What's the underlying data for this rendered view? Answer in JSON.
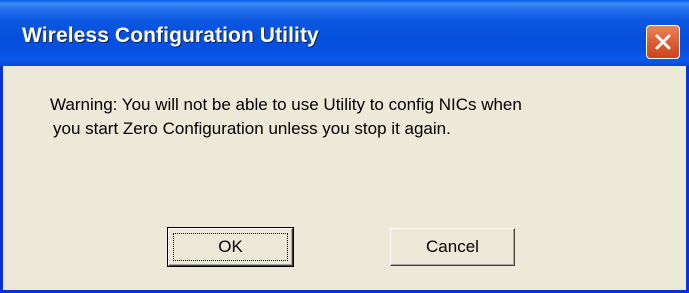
{
  "window": {
    "title": "Wireless Configuration Utility"
  },
  "message": {
    "line1": "Warning: You will not be able to use Utility to config NICs when",
    "line2": "you start Zero Configuration unless you stop it again."
  },
  "buttons": {
    "ok_label": "OK",
    "cancel_label": "Cancel"
  },
  "icons": {
    "close": "close-icon"
  },
  "colors": {
    "titlebar": "#0550e0",
    "window_border": "#0831d9",
    "dialog_face": "#ece9d8",
    "close_button": "#e0643a"
  }
}
